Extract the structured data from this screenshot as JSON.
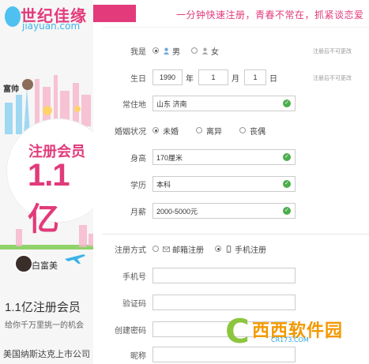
{
  "brand": {
    "name_cn": "世纪佳缘",
    "name_en": "jiayuan.com",
    "accent": "#e23a7a",
    "blue": "#3bb3e8"
  },
  "slogan": "一分钟快速注册，青春不常在，抓紧谈恋爱",
  "promo": {
    "tag_rich": "富帅",
    "tag_fair": "白富美",
    "title": "注册会员",
    "count": "1.1亿",
    "stat_heading": "1.1亿注册会员",
    "stat_sub": "给你千万里挑一的机会",
    "stat_note": "美国纳斯达克上市公司"
  },
  "form": {
    "gender": {
      "label": "我是",
      "options": [
        "男",
        "女"
      ],
      "selected": "男",
      "hint": "注册后不可更改"
    },
    "birthday": {
      "label": "生日",
      "year": "1990",
      "year_unit": "年",
      "month": "1",
      "month_unit": "月",
      "day": "1",
      "day_unit": "日",
      "hint": "注册后不可更改"
    },
    "residence": {
      "label": "常住地",
      "value": "山东 济南"
    },
    "marital": {
      "label": "婚姻状况",
      "options": [
        "未婚",
        "离异",
        "丧偶"
      ],
      "selected": "未婚"
    },
    "height": {
      "label": "身高",
      "value": "170厘米"
    },
    "education": {
      "label": "学历",
      "value": "本科"
    },
    "income": {
      "label": "月薪",
      "value": "2000-5000元"
    },
    "reg_method": {
      "label": "注册方式",
      "options": [
        "邮箱注册",
        "手机注册"
      ],
      "selected": "手机注册"
    },
    "phone": {
      "label": "手机号",
      "value": ""
    },
    "captcha": {
      "label": "验证码",
      "value": ""
    },
    "password": {
      "label": "创建密码",
      "value": ""
    },
    "nickname": {
      "label": "昵称",
      "value": ""
    }
  },
  "watermark": {
    "text": "西西软件园",
    "url": "CR173.COM"
  }
}
